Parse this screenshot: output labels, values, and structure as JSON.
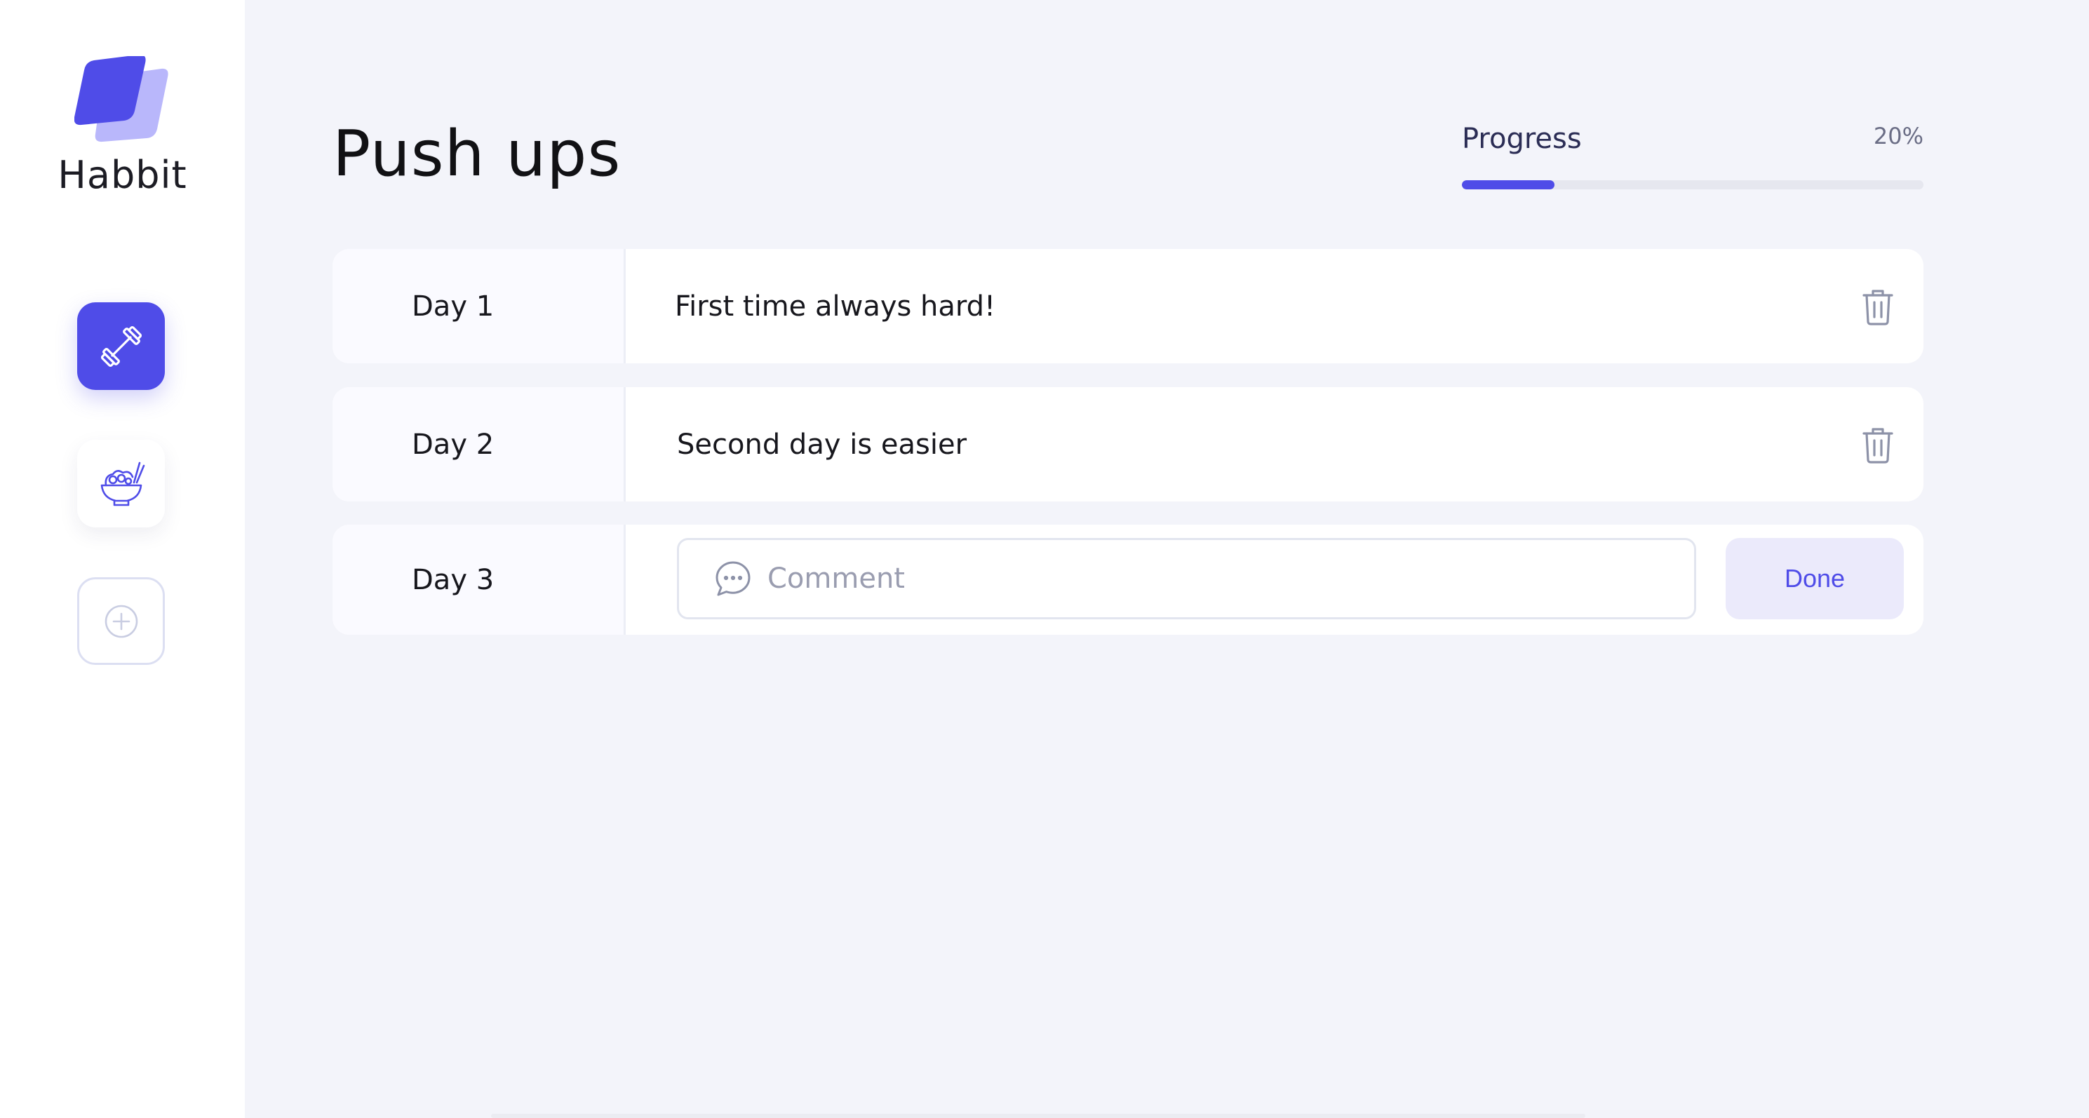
{
  "app": {
    "name": "Habbit",
    "brand_color": "#4f4ce8",
    "brand_color_light": "#b9b7fb"
  },
  "sidebar": {
    "items": [
      {
        "icon": "dumbbell-icon",
        "active": true
      },
      {
        "icon": "noodle-bowl-icon",
        "active": false
      },
      {
        "icon": "plus-circle-icon",
        "active": false
      }
    ]
  },
  "habit": {
    "title": "Push ups",
    "progress": {
      "label": "Progress",
      "value_text": "20%",
      "percent": 20
    }
  },
  "days": [
    {
      "label": "Day 1",
      "comment": "First time always hard!",
      "action_icon": "trash-icon"
    },
    {
      "label": "Day 2",
      "comment": "Second day is easier",
      "action_icon": "trash-icon"
    },
    {
      "label": "Day 3",
      "comment_icon": "chat-bubble-icon",
      "input_value": "",
      "placeholder": "Comment",
      "action_label": "Done"
    }
  ]
}
